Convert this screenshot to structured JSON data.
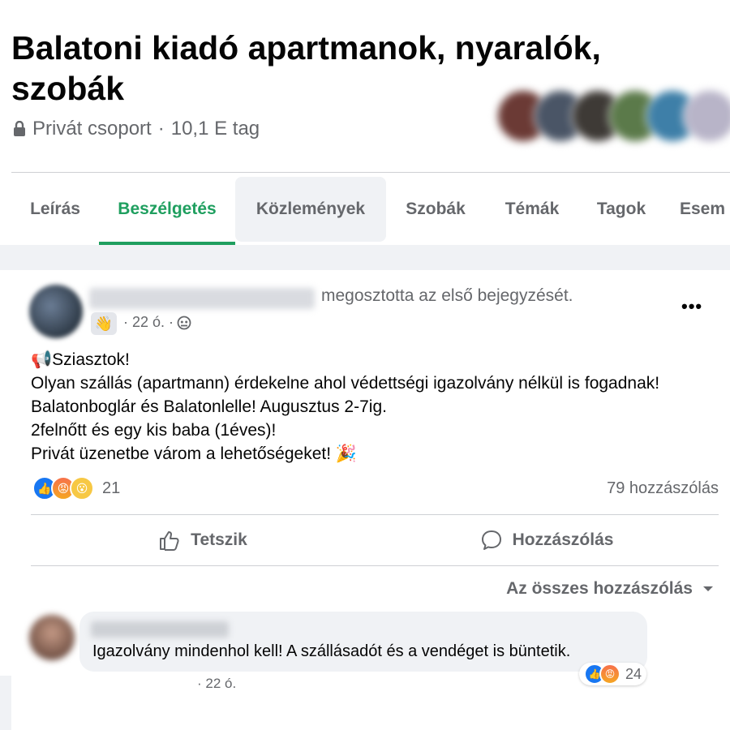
{
  "group": {
    "title": "Balatoni kiadó apartmanok, nyaralók, szobák",
    "privacy": "Privát csoport",
    "separator": "·",
    "members": "10,1 E tag"
  },
  "tabs": [
    {
      "label": "Leírás"
    },
    {
      "label": "Beszélgetés"
    },
    {
      "label": "Közlemények"
    },
    {
      "label": "Szobák"
    },
    {
      "label": "Témák"
    },
    {
      "label": "Tagok"
    },
    {
      "label": "Esem"
    }
  ],
  "post": {
    "shared_text": "megosztotta az első bejegyzését.",
    "time": "· 22 ó. ·",
    "more": "•••",
    "body": [
      "📢Sziasztok!",
      "Olyan szállás (apartmann) érdekelne ahol védettségi igazolvány nélkül is fogadnak!",
      "Balatonboglár és Balatonlelle! Augusztus 2-7ig.",
      "2felnőtt és egy kis baba (1éves)!",
      "Privát üzenetbe várom a lehetőségeket! 🎉"
    ],
    "reaction_count": "21",
    "comment_count": "79 hozzászólás",
    "like_label": "Tetszik",
    "comment_label": "Hozzászólás"
  },
  "comments_filter": "Az összes hozzászólás",
  "comment": {
    "text": "Igazolvány mindenhol kell! A szállásadót és a vendéget is büntetik.",
    "reaction_count": "24",
    "time": "· 22 ó."
  },
  "colors": {
    "accent": "#1f9f5f",
    "like": "#1877f2",
    "text_secondary": "#65676b",
    "bg": "#f0f2f5"
  }
}
